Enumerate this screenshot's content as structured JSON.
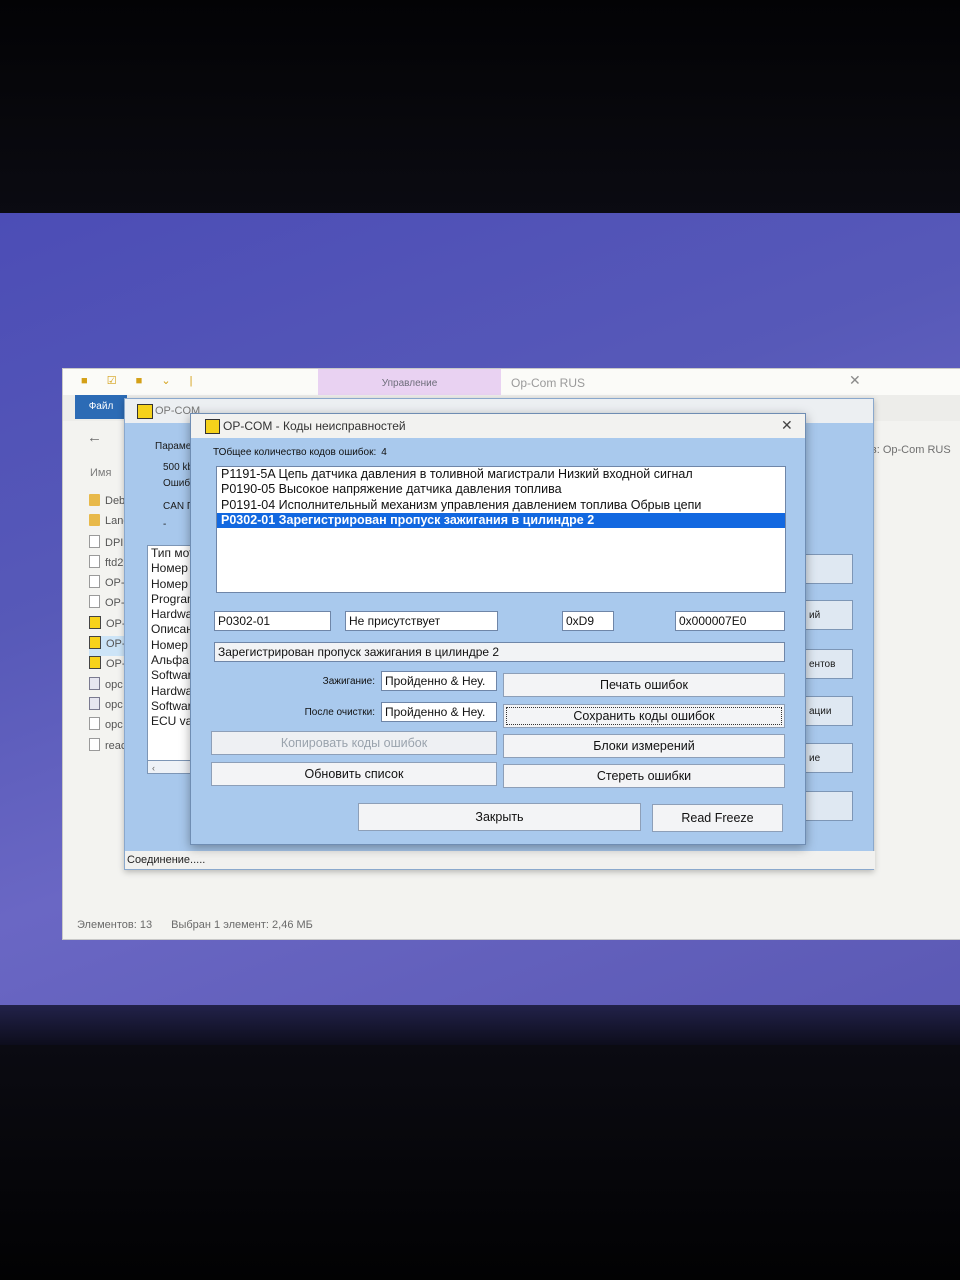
{
  "explorer": {
    "ribbon_tab_manage": "Управление",
    "window_title": "Op-Com RUS",
    "file_tab": "Файл",
    "column_name": "Имя",
    "search_hint": "к в: Op-Com RUS",
    "files": [
      {
        "name": "Deb",
        "icon": "folder-icon"
      },
      {
        "name": "Lang",
        "icon": "folder-icon"
      },
      {
        "name": "DPI",
        "icon": "document-icon"
      },
      {
        "name": "ftd2",
        "icon": "document-icon"
      },
      {
        "name": "OP-",
        "icon": "document-icon"
      },
      {
        "name": "OP-",
        "icon": "document-icon"
      },
      {
        "name": "OP-",
        "icon": "opcom-icon"
      },
      {
        "name": "OP-",
        "icon": "opcom-icon"
      },
      {
        "name": "OP-",
        "icon": "opcom-icon"
      },
      {
        "name": "opc",
        "icon": "executable-icon"
      },
      {
        "name": "opc",
        "icon": "executable-icon"
      },
      {
        "name": "opc",
        "icon": "document-icon"
      },
      {
        "name": "reac",
        "icon": "document-icon"
      }
    ],
    "status_items": "Элементов: 13",
    "status_selected": "Выбран 1 элемент: 2,46 МБ"
  },
  "opcom_main": {
    "title": "OP-COM",
    "params_label": "Парамет",
    "params_lines": [
      "500 kb",
      "Ошибк",
      "CAN П",
      "-"
    ],
    "info_list": [
      "Тип мото",
      "Номер д",
      "Номер е",
      "Program",
      "Hardwar",
      "Описан",
      "Номер т",
      "Альфа к",
      "Software",
      "Hardwar",
      "Software",
      "ECU var"
    ],
    "right_buttons": [
      "",
      "ий",
      "ентов",
      "ации",
      "ие",
      ""
    ],
    "status": "Соединение....."
  },
  "dialog": {
    "title": "OP-COM - Коды неисправностей",
    "total_label": "ТОбщее количество кодов ошибок:",
    "total_count": "4",
    "codes": [
      "P1191-5A Цепь датчика давления в толивной магистрали  Низкий входной сигнал",
      "P0190-05 Высокое напряжение датчика давления топлива",
      "P0191-04 Исполнительный механизм управления давлением топлива Обрыв цепи",
      "P0302-01 Зарегистрирован пропуск зажигания в цилиндре 2"
    ],
    "selected_index": 3,
    "code_field": "P0302-01",
    "presence_field": "Не присутствует",
    "hex1_field": "0xD9",
    "hex2_field": "0x000007E0",
    "description_field": "Зарегистрирован пропуск зажигания в цилиндре 2",
    "ignition_label": "Зажигание:",
    "ignition_value": "Пройденно & Неу.",
    "after_clear_label": "После очистки:",
    "after_clear_value": "Пройденно & Неу.",
    "buttons": {
      "print": "Печать ошибок",
      "save": "Сохранить коды ошибок",
      "copy": "Копировать коды ошибок",
      "measure": "Блоки измерений",
      "refresh": "Обновить список",
      "erase": "Стереть ошибки",
      "close": "Закрыть",
      "read_freeze": "Read Freeze"
    }
  },
  "colors": {
    "dialog_bg": "#a9c9ed",
    "selection": "#1268e0",
    "desktop": "#5759b8"
  }
}
